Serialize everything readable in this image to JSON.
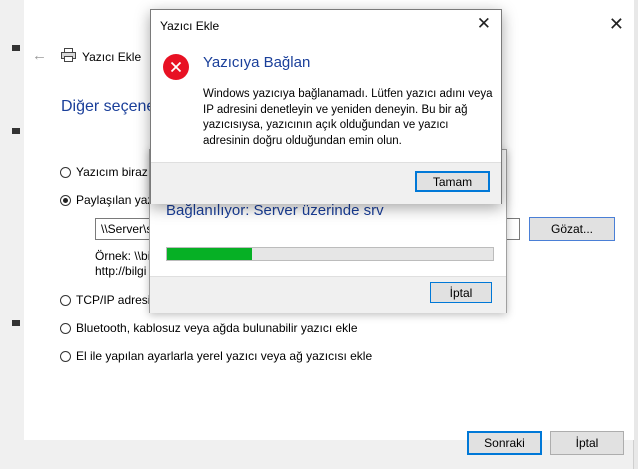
{
  "main_window": {
    "title": "Yazıcı Ekle",
    "heading": "Diğer seçene",
    "options": [
      {
        "label": "Yazıcım biraz e",
        "selected": false
      },
      {
        "label": "Paylaşılan yaz",
        "selected": true
      },
      {
        "label": "TCP/IP adresi v",
        "selected": false
      },
      {
        "label": "Bluetooth, kablosuz veya ağda bulunabilir yazıcı ekle",
        "selected": false
      },
      {
        "label": "El ile yapılan ayarlarla yerel yazıcı veya ağ yazıcısı ekle",
        "selected": false
      }
    ],
    "share_path_value": "\\\\Server\\s",
    "browse_label": "Gözat...",
    "example_line1": "Örnek: \\\\bi",
    "example_line2": "http://bilgi",
    "next_label": "Sonraki",
    "cancel_label": "İptal"
  },
  "progress_dialog": {
    "status": "Bağlanılıyor: Server üzerinde srv",
    "progress_percent": 26,
    "cancel_label": "İptal"
  },
  "error_dialog": {
    "caption": "Yazıcı Ekle",
    "heading": "Yazıcıya Bağlan",
    "message": "Windows yazıcıya bağlanamadı. Lütfen yazıcı adını veya IP adresini denetleyin ve yeniden deneyin. Bu bir ağ yazıcısıysa, yazıcının açık olduğundan ve yazıcı adresinin doğru olduğundan emin olun.",
    "ok_label": "Tamam"
  },
  "colors": {
    "accent": "#0078d7",
    "heading_blue": "#1a3f9a",
    "progress_green": "#06b025",
    "error_red": "#e81123"
  }
}
